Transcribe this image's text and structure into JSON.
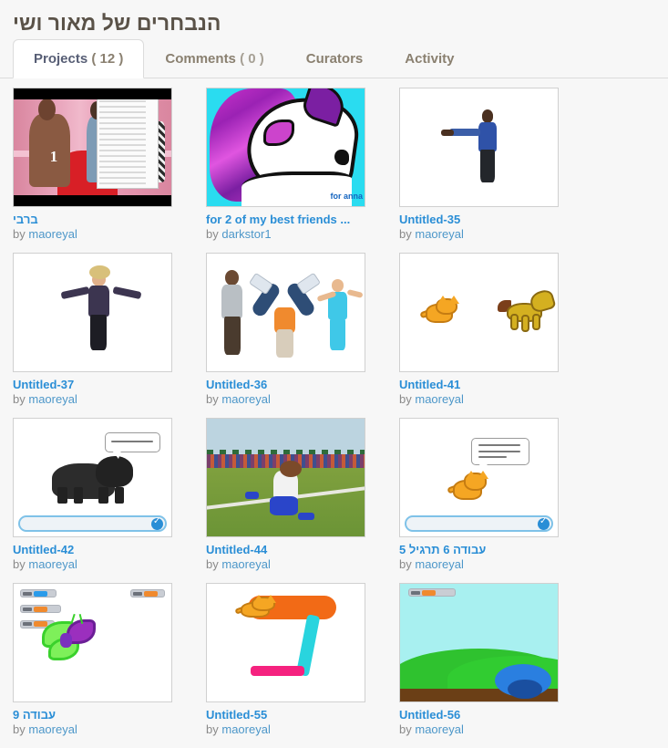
{
  "header": {
    "title": "הנבחרים של מאור ושי"
  },
  "tabs": [
    {
      "label": "Projects",
      "count": "( 12 )",
      "active": true,
      "name": "tab-projects"
    },
    {
      "label": "Comments",
      "count": "( 0 )",
      "active": false,
      "name": "tab-comments"
    },
    {
      "label": "Curators",
      "count": "",
      "active": false,
      "name": "tab-curators"
    },
    {
      "label": "Activity",
      "count": "",
      "active": false,
      "name": "tab-activity"
    }
  ],
  "by_label": "by",
  "projects": [
    {
      "title": "ברבי",
      "author": "maoreyal",
      "rtl": true,
      "art": "barbie"
    },
    {
      "title": "for 2 of my best friends ...",
      "author": "darkstor1",
      "rtl": false,
      "art": "unicorn"
    },
    {
      "title": "Untitled-35",
      "author": "maoreyal",
      "rtl": false,
      "art": "boy-dance"
    },
    {
      "title": "Untitled-37",
      "author": "maoreyal",
      "rtl": false,
      "art": "girl-dance"
    },
    {
      "title": "Untitled-36",
      "author": "maoreyal",
      "rtl": false,
      "art": "breakdance"
    },
    {
      "title": "Untitled-41",
      "author": "maoreyal",
      "rtl": false,
      "art": "cat-horse"
    },
    {
      "title": "Untitled-42",
      "author": "maoreyal",
      "rtl": false,
      "art": "dog-ask"
    },
    {
      "title": "Untitled-44",
      "author": "maoreyal",
      "rtl": false,
      "art": "runner"
    },
    {
      "title": "עבודה 6 תרגיל 5",
      "author": "maoreyal",
      "rtl": true,
      "art": "cat-ask"
    },
    {
      "title": "עבודה 9",
      "author": "maoreyal",
      "rtl": true,
      "art": "butterfly"
    },
    {
      "title": "Untitled-55",
      "author": "maoreyal",
      "rtl": false,
      "art": "pen-lines"
    },
    {
      "title": "Untitled-56",
      "author": "maoreyal",
      "rtl": false,
      "art": "landscape"
    }
  ],
  "colors": {
    "link": "#2a8ed6",
    "title_text": "#5a5248",
    "tab_inactive": "#8a8070",
    "author": "#8a8a8a",
    "page_bg": "#f7f7f7",
    "card_border": "#d0d0d0"
  }
}
